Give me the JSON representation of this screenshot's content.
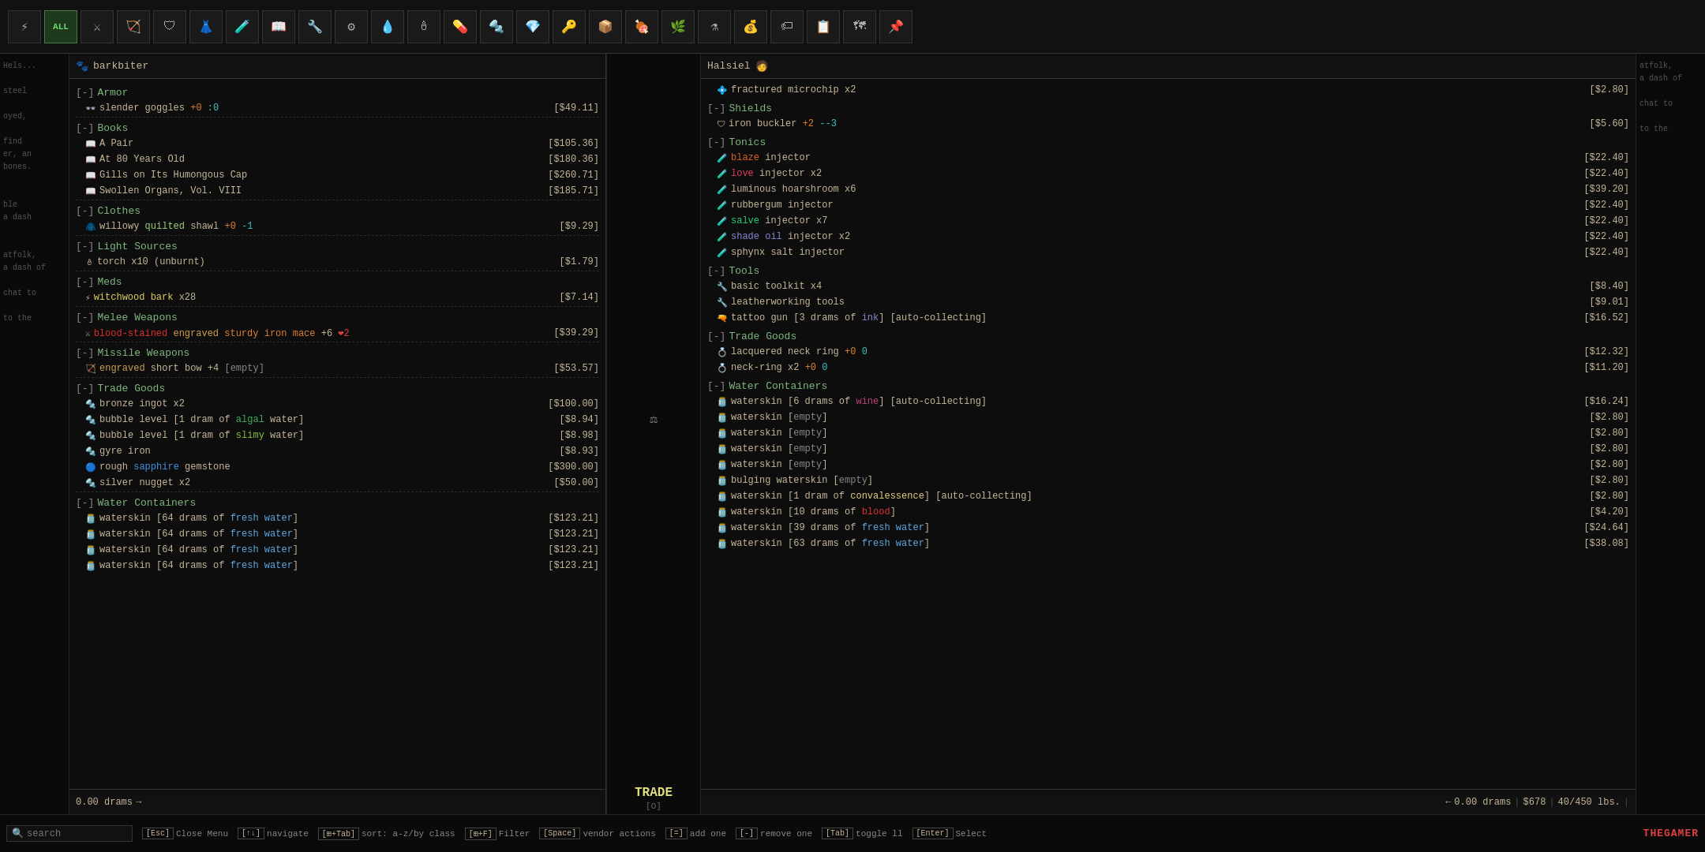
{
  "topBar": {
    "buttons": [
      {
        "label": "⚡",
        "id": "electric"
      },
      {
        "label": "ALL",
        "id": "all",
        "active": true
      },
      {
        "label": "🗡",
        "id": "weapon"
      },
      {
        "label": "🎯",
        "id": "ranged"
      },
      {
        "label": "🛡",
        "id": "armor"
      },
      {
        "label": "👗",
        "id": "clothes"
      },
      {
        "label": "🧪",
        "id": "tonic"
      },
      {
        "label": "✏",
        "id": "book"
      },
      {
        "label": "🔧",
        "id": "tool"
      },
      {
        "label": "⚙",
        "id": "gear"
      },
      {
        "label": "💧",
        "id": "water"
      },
      {
        "label": "🕯",
        "id": "light"
      },
      {
        "label": "💊",
        "id": "med"
      },
      {
        "label": "🔩",
        "id": "part"
      },
      {
        "label": "💎",
        "id": "gem"
      },
      {
        "label": "🔑",
        "id": "key"
      },
      {
        "label": "📦",
        "id": "trade"
      },
      {
        "label": "🍖",
        "id": "food"
      },
      {
        "label": "🌿",
        "id": "plant"
      },
      {
        "label": "⚗",
        "id": "alch"
      },
      {
        "label": "💰",
        "id": "coin"
      },
      {
        "label": "🏷",
        "id": "tag"
      },
      {
        "label": "📋",
        "id": "misc"
      },
      {
        "label": "🗺",
        "id": "map"
      },
      {
        "label": "📌",
        "id": "pin"
      }
    ]
  },
  "leftPanel": {
    "playerName": "barkbiter",
    "categories": [
      {
        "name": "Armor",
        "collapsed": false,
        "items": [
          {
            "icon": "👓",
            "name": "slender goggles",
            "suffix": " +0  :0",
            "price": "[$49.11]"
          },
          {
            "divider": true
          }
        ]
      },
      {
        "name": "Books",
        "collapsed": false,
        "items": [
          {
            "icon": "📖",
            "name": "A Pair",
            "price": "[$105.36]"
          },
          {
            "icon": "📖",
            "name": "At 80 Years Old",
            "price": "[$180.36]"
          },
          {
            "icon": "📖",
            "name": "Gills on Its Humongous Cap",
            "price": "[$260.71]"
          },
          {
            "icon": "📖",
            "name": "Swollen Organs, Vol. VIII",
            "price": "[$185.71]"
          },
          {
            "divider": true
          }
        ]
      },
      {
        "name": "Clothes",
        "collapsed": false,
        "items": [
          {
            "icon": "🧥",
            "name": "willowy quilted shawl",
            "suffix": " +0  -1",
            "quilted": true,
            "price": "[$9.29]"
          },
          {
            "divider": true
          }
        ]
      },
      {
        "name": "Light Sources",
        "collapsed": false,
        "items": [
          {
            "icon": "🕯",
            "name": "torch x10 (unburnt)",
            "price": "[$1.79]"
          },
          {
            "divider": true
          }
        ]
      },
      {
        "name": "Meds",
        "collapsed": false,
        "items": [
          {
            "icon": "⚡",
            "name": "witchwood bark x28",
            "price": "[$7.14]"
          },
          {
            "divider": true
          }
        ]
      },
      {
        "name": "Melee Weapons",
        "collapsed": false,
        "items": [
          {
            "icon": "🗡",
            "name": "blood-stained engraved sturdy iron mace +6 ❤2",
            "price": "[$39.29]",
            "special": true
          },
          {
            "divider": true
          }
        ]
      },
      {
        "name": "Missile Weapons",
        "collapsed": false,
        "items": [
          {
            "icon": "🏹",
            "name": "engraved short bow +4 [empty]",
            "price": "[$53.57]"
          },
          {
            "divider": true
          }
        ]
      },
      {
        "name": "Trade Goods",
        "collapsed": false,
        "items": [
          {
            "icon": "🔩",
            "name": "bronze ingot x2",
            "price": "[$100.00]"
          },
          {
            "icon": "🔩",
            "name": "bubble level [1 dram of algal water]",
            "price": "[$8.94]",
            "colorWord": "algal"
          },
          {
            "icon": "🔩",
            "name": "bubble level [1 dram of slimy water]",
            "price": "[$8.98]",
            "colorWord": "slimy"
          },
          {
            "icon": "🔩",
            "name": "gyre iron",
            "price": "[$8.93]"
          },
          {
            "icon": "💎",
            "name": "rough sapphire gemstone",
            "price": "[$300.00]",
            "colorWord": "sapphire"
          },
          {
            "icon": "🔩",
            "name": "silver nugget x2",
            "price": "[$50.00]"
          },
          {
            "divider": true
          }
        ]
      },
      {
        "name": "Water Containers",
        "collapsed": false,
        "items": [
          {
            "icon": "🫙",
            "name": "waterskin [64 drams of fresh water]",
            "price": "[$123.21]",
            "colorWord": "fresh"
          },
          {
            "icon": "🫙",
            "name": "waterskin [64 drams of fresh water]",
            "price": "[$123.21]",
            "colorWord": "fresh"
          },
          {
            "icon": "🫙",
            "name": "waterskin [64 drams of fresh water]",
            "price": "[$123.21]",
            "colorWord": "fresh"
          },
          {
            "icon": "🫙",
            "name": "waterskin [64 drams of fresh water]",
            "price": "[$123.21]",
            "colorWord": "fresh"
          }
        ]
      }
    ],
    "drams": "0.00 drams"
  },
  "rightPanel": {
    "vendorName": "Halsiel",
    "categories": [
      {
        "name": "misc_top",
        "items": [
          {
            "icon": "🔩",
            "name": "fractured microchip x2",
            "price": "[$2.80]"
          }
        ]
      },
      {
        "name": "Shields",
        "collapsed": false,
        "items": [
          {
            "icon": "🛡",
            "name": "iron buckler +2  --3",
            "price": "[$5.60]"
          }
        ]
      },
      {
        "name": "Tonics",
        "collapsed": false,
        "items": [
          {
            "icon": "🧪",
            "name": "blaze injector",
            "price": "[$22.40]",
            "colorWord": "blaze"
          },
          {
            "icon": "🧪",
            "name": "love injector x2",
            "price": "[$22.40]",
            "colorWord": "love"
          },
          {
            "icon": "🧪",
            "name": "luminous hoarshroom x6",
            "price": "[$39.20]"
          },
          {
            "icon": "🧪",
            "name": "rubbergum injector",
            "price": "[$22.40]"
          },
          {
            "icon": "🧪",
            "name": "salve injector x7",
            "price": "[$22.40]",
            "colorWord": "salve"
          },
          {
            "icon": "🧪",
            "name": "shade oil injector x2",
            "price": "[$22.40]",
            "colorWord": "shade"
          },
          {
            "icon": "🧪",
            "name": "sphynx salt injector",
            "price": "[$22.40]"
          }
        ]
      },
      {
        "name": "Tools",
        "collapsed": false,
        "items": [
          {
            "icon": "🔧",
            "name": "basic toolkit x4",
            "price": "[$8.40]"
          },
          {
            "icon": "🔧",
            "name": "leatherworking tools",
            "price": "[$9.01]"
          },
          {
            "icon": "🔫",
            "name": "tattoo gun [3 drams of ink] [auto-collecting]",
            "price": "[$16.52]",
            "colorWord": "ink"
          }
        ]
      },
      {
        "name": "Trade Goods",
        "collapsed": false,
        "items": [
          {
            "icon": "💍",
            "name": "lacquered neck ring +0  0",
            "price": "[$12.32]"
          },
          {
            "icon": "💍",
            "name": "neck-ring x2 +0  0",
            "price": "[$11.20]"
          }
        ]
      },
      {
        "name": "Water Containers",
        "collapsed": false,
        "items": [
          {
            "icon": "🫙",
            "name": "waterskin [6 drams of wine] [auto-collecting]",
            "price": "[$16.24]",
            "colorWord": "wine"
          },
          {
            "icon": "🫙",
            "name": "waterskin [empty]",
            "price": "[$2.80]"
          },
          {
            "icon": "🫙",
            "name": "waterskin [empty]",
            "price": "[$2.80]"
          },
          {
            "icon": "🫙",
            "name": "waterskin [empty]",
            "price": "[$2.80]"
          },
          {
            "icon": "🫙",
            "name": "waterskin [empty]",
            "price": "[$2.80]"
          },
          {
            "icon": "🫙",
            "name": "bulging waterskin [empty]",
            "price": "[$2.80]"
          },
          {
            "icon": "🫙",
            "name": "waterskin [1 dram of convalessence] [auto-collecting]",
            "price": "[$2.80]",
            "colorWord": "conval"
          },
          {
            "icon": "🫙",
            "name": "waterskin [10 drams of blood]",
            "price": "[$4.20]",
            "colorWord": "blood"
          },
          {
            "icon": "🫙",
            "name": "waterskin [39 drams of fresh water]",
            "price": "[$24.64]",
            "colorWord": "fresh"
          },
          {
            "icon": "🫙",
            "name": "waterskin [63 drams of fresh water]",
            "price": "[$38.08]",
            "colorWord": "fresh"
          }
        ]
      }
    ],
    "drams": "0.00 drams",
    "money": "$678",
    "weight": "40/450 lbs."
  },
  "tradeCenter": {
    "leftArrow": "← 0.00 drams",
    "rightArrow": "0.00 drams →",
    "label": "TRADE",
    "sublabel": "[O]"
  },
  "keybinds": [
    {
      "key": "Esc",
      "label": "Close Menu"
    },
    {
      "key": "↑↓",
      "label": "navigate"
    },
    {
      "key": "⊞+Tab",
      "label": "sort: a-z/by class"
    },
    {
      "key": "⊞+F",
      "label": "Filter"
    },
    {
      "key": "Space",
      "label": "vendor actions"
    },
    {
      "key": "[=]",
      "label": "add one"
    },
    {
      "key": "[-]",
      "label": "remove one"
    },
    {
      "key": "Tab",
      "label": "toggle ll"
    },
    {
      "key": "Enter",
      "label": "Select"
    }
  ],
  "searchBar": {
    "placeholder": "search",
    "icon": "🔍"
  }
}
